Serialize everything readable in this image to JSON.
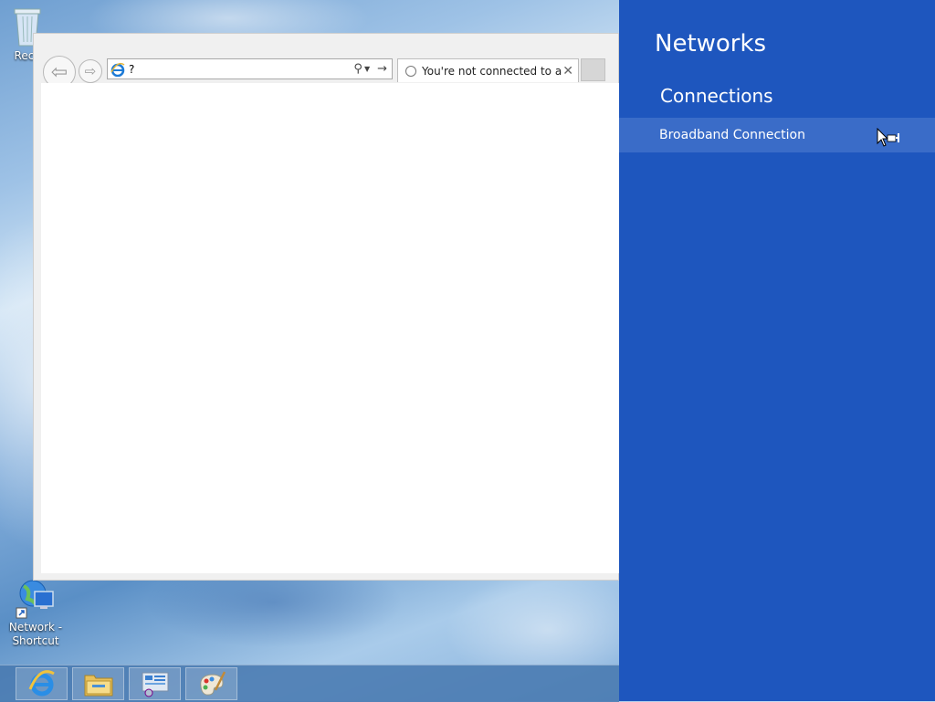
{
  "desktop": {
    "icons": [
      {
        "label": "Recy",
        "icon": "recycle-bin-icon"
      },
      {
        "label": "Network -\nShortcut",
        "icon": "network-globe-icon"
      }
    ]
  },
  "browser": {
    "address_value": "?",
    "tab_title": "You're not connected to a ...",
    "icons": [
      "back-arrow-icon",
      "forward-arrow-icon",
      "ie-icon",
      "search-icon",
      "dropdown-icon",
      "go-arrow-icon",
      "loading-spinner-icon",
      "close-icon"
    ]
  },
  "taskbar": {
    "items": [
      {
        "icon": "internet-explorer-icon"
      },
      {
        "icon": "file-explorer-icon"
      },
      {
        "icon": "server-manager-icon"
      },
      {
        "icon": "paint-icon"
      }
    ]
  },
  "charm": {
    "title": "Networks",
    "section": "Connections",
    "connections": [
      {
        "name": "Broadband Connection",
        "icon": "wired-connection-icon"
      }
    ]
  },
  "colors": {
    "charm_bg": "#1e56be",
    "charm_row_bg": "#3a6cc8"
  }
}
